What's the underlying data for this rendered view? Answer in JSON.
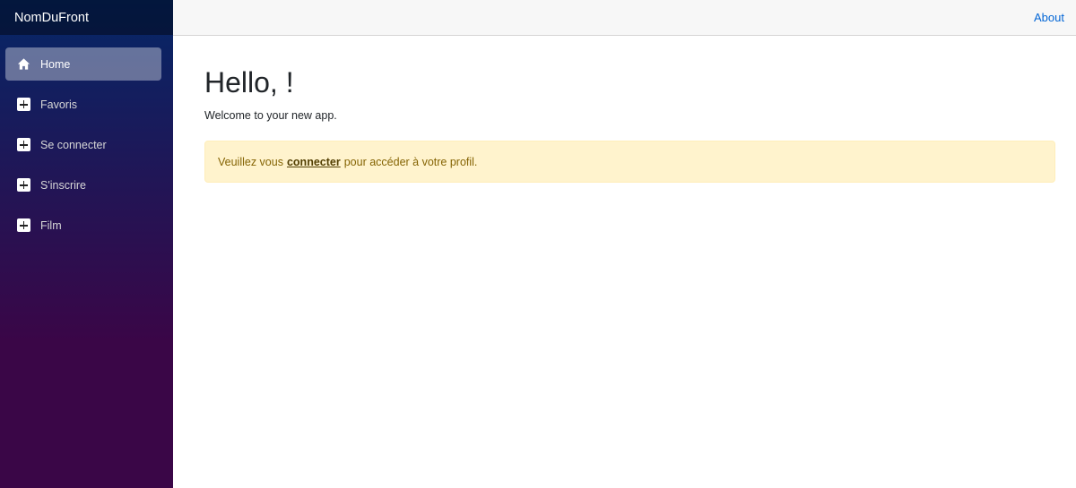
{
  "sidebar": {
    "brand": "NomDuFront",
    "items": [
      {
        "label": "Home",
        "icon": "home-icon",
        "active": true
      },
      {
        "label": "Favoris",
        "icon": "plus-icon"
      },
      {
        "label": "Se connecter",
        "icon": "plus-icon"
      },
      {
        "label": "S'inscrire",
        "icon": "plus-icon"
      },
      {
        "label": "Film",
        "icon": "plus-icon"
      }
    ]
  },
  "topbar": {
    "about_label": "About"
  },
  "main": {
    "title": "Hello, !",
    "subtitle": "Welcome to your new app.",
    "alert": {
      "before": "Veuillez vous",
      "link": "connecter",
      "after": "pour accéder à votre profil."
    }
  },
  "colors": {
    "sidebar_top": "#052767",
    "sidebar_bottom": "#3a0647",
    "link": "#0366d6",
    "alert_bg": "#fff3cd",
    "alert_text": "#856404"
  }
}
